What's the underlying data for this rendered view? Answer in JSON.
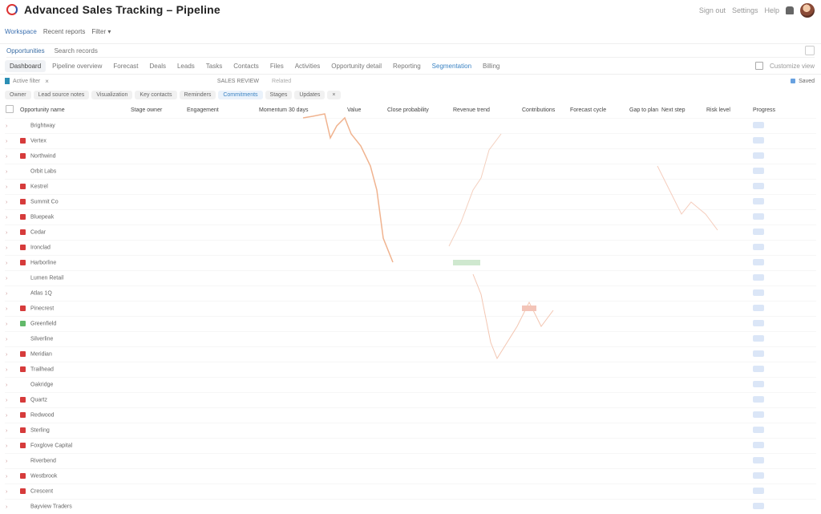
{
  "app": {
    "title": "Advanced Sales Tracking – Pipeline",
    "topbar_links": [
      "Sign out",
      "Settings",
      "Help"
    ]
  },
  "subnav": {
    "items": [
      "Workspace",
      "Recent reports",
      "Filter"
    ],
    "active_index": 0
  },
  "search": {
    "scope": "Opportunities",
    "placeholder": "Search records"
  },
  "tabs": {
    "items": [
      "Dashboard",
      "Pipeline overview",
      "Forecast",
      "Deals",
      "Leads",
      "Tasks",
      "Contacts",
      "Files",
      "Activities",
      "Opportunity detail",
      "Reporting",
      "Segmentation",
      "Billing"
    ],
    "active_index": 0,
    "link_index": 11,
    "right_label": "Customize view"
  },
  "filter": {
    "label": "Active filter",
    "center_label": "SALES REVIEW",
    "center_link": "Related",
    "status_label": "Saved"
  },
  "chips": {
    "items": [
      "Owner",
      "Lead source notes",
      "Visualization",
      "Key contacts",
      "Reminders",
      "Commitments",
      "Stages",
      "Updates"
    ],
    "active_index": 5
  },
  "table": {
    "columns": [
      "Opportunity name",
      "Stage owner",
      "Engagement",
      "Momentum 30 days",
      "Value",
      "Close probability",
      "Revenue trend",
      "Contributions",
      "Forecast cycle",
      "Gap to plan",
      "Next step",
      "Risk level",
      "Progress"
    ],
    "rows": [
      {
        "name": "Brightway",
        "icon": "plain"
      },
      {
        "name": "Vertex",
        "icon": "red"
      },
      {
        "name": "Northwind",
        "icon": "red"
      },
      {
        "name": "Orbit Labs",
        "icon": "plain"
      },
      {
        "name": "Kestrel",
        "icon": "red"
      },
      {
        "name": "Summit Co",
        "icon": "red"
      },
      {
        "name": "Bluepeak",
        "icon": "red"
      },
      {
        "name": "Cedar",
        "icon": "red"
      },
      {
        "name": "Ironclad",
        "icon": "red"
      },
      {
        "name": "Harborline",
        "icon": "red"
      },
      {
        "name": "Lumen Retail",
        "icon": "plain"
      },
      {
        "name": "Atlas 1Q",
        "icon": "plain"
      },
      {
        "name": "Pinecrest",
        "icon": "red"
      },
      {
        "name": "Greenfield",
        "icon": "green"
      },
      {
        "name": "Silverline",
        "icon": "plain"
      },
      {
        "name": "Meridian",
        "icon": "red"
      },
      {
        "name": "Trailhead",
        "icon": "red"
      },
      {
        "name": "Oakridge",
        "icon": "plain"
      },
      {
        "name": "Quartz",
        "icon": "red"
      },
      {
        "name": "Redwood",
        "icon": "red"
      },
      {
        "name": "Sterling",
        "icon": "red"
      },
      {
        "name": "Foxglove Capital",
        "icon": "red"
      },
      {
        "name": "Riverbend",
        "icon": "plain"
      },
      {
        "name": "Westbrook",
        "icon": "red"
      },
      {
        "name": "Crescent",
        "icon": "red"
      },
      {
        "name": "Bayview Traders",
        "icon": "plain"
      }
    ]
  },
  "colors": {
    "accent": "#3b83c3",
    "danger": "#d63b3b",
    "success": "#62b96a",
    "muted": "#aaaaaa"
  }
}
